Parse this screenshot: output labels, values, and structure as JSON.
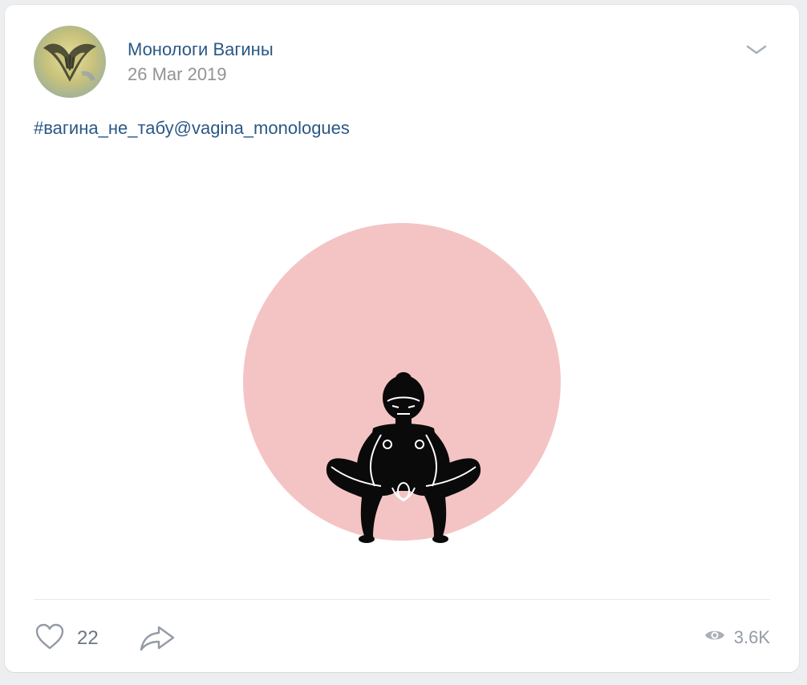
{
  "post": {
    "author": "Монологи Вагины",
    "date": "26 Mar 2019",
    "text": "#вагина_не_табу@vagina_monologues",
    "likes": "22",
    "views": "3.6K"
  },
  "icons": {
    "menu": "chevron-down-icon",
    "like": "heart-icon",
    "share": "share-arrow-icon",
    "views": "eye-icon"
  },
  "colors": {
    "link": "#2a5885",
    "muted": "#939393",
    "image_circle": "#f4c4c4",
    "figure": "#0a0a0a"
  }
}
